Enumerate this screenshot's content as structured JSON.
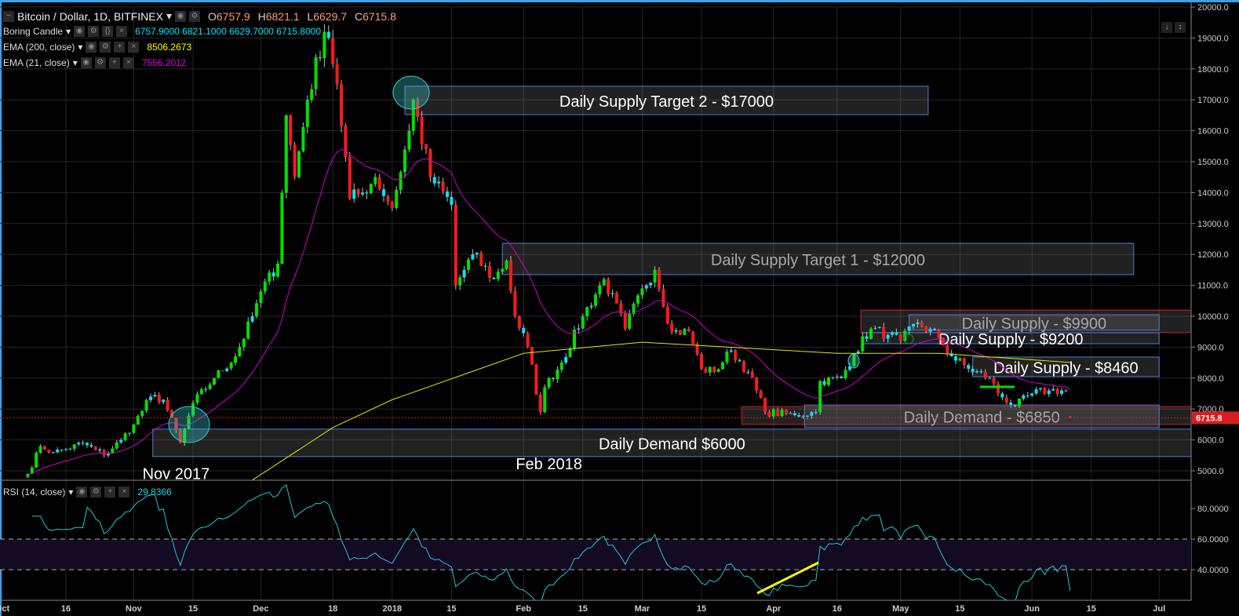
{
  "header": {
    "symbol": "Bitcoin / Dollar, 1D, BITFINEX",
    "open_label": "O",
    "open": "6757.9",
    "high_label": "H",
    "high": "6821.1",
    "low_label": "L",
    "low": "6629.7",
    "close_label": "C",
    "close": "6715.8"
  },
  "indicators": [
    {
      "name": "Boring Candle",
      "values": "6757.9000  6821.1000  6629.7000  6715.8000",
      "color": "#00e5ff"
    },
    {
      "name": "EMA (200, close)",
      "values": "8506.2673",
      "color": "#ffff00"
    },
    {
      "name": "EMA (21, close)",
      "values": "7556.2012",
      "color": "#e000e0"
    }
  ],
  "rsi_legend": {
    "name": "RSI (14, close)",
    "value": "29.8366"
  },
  "colors": {
    "up": "#00e000",
    "down": "#ff1a1a",
    "boring": "#00e5ff",
    "ema200": "#e6e600",
    "ema21": "#d000d0",
    "rsi": "#1fc8d8",
    "zone_blue": "#4a7fd8",
    "zone_red": "#d81e1e",
    "current": "#d81e1e"
  },
  "chart_data": {
    "type": "candlestick",
    "title": "Bitcoin / Dollar, 1D, BITFINEX",
    "start_date": "2017-10-01",
    "x_ticks": [
      {
        "day": 0,
        "label": "Oct"
      },
      {
        "day": 15,
        "label": "16"
      },
      {
        "day": 31,
        "label": "Nov"
      },
      {
        "day": 45,
        "label": "15"
      },
      {
        "day": 61,
        "label": "Dec"
      },
      {
        "day": 78,
        "label": "18"
      },
      {
        "day": 92,
        "label": "2018"
      },
      {
        "day": 106,
        "label": "15"
      },
      {
        "day": 123,
        "label": "Feb"
      },
      {
        "day": 137,
        "label": "15"
      },
      {
        "day": 151,
        "label": "Mar"
      },
      {
        "day": 165,
        "label": "15"
      },
      {
        "day": 182,
        "label": "Apr"
      },
      {
        "day": 197,
        "label": "16"
      },
      {
        "day": 212,
        "label": "May"
      },
      {
        "day": 226,
        "label": "15"
      },
      {
        "day": 243,
        "label": "Jun"
      },
      {
        "day": 257,
        "label": "15"
      },
      {
        "day": 273,
        "label": "Jul"
      }
    ],
    "x_range_days": [
      0,
      280
    ],
    "y_range": [
      4700,
      20150
    ],
    "y_ticks": [
      "20000.0",
      "19000.0",
      "18000.0",
      "17000.0",
      "16000.0",
      "15000.0",
      "14000.0",
      "13000.0",
      "12000.0",
      "11000.0",
      "10000.0",
      "9000.0",
      "8000.0",
      "7000.0",
      "6000.0",
      "5000.0"
    ],
    "current_price": "6715.8",
    "close_anchors": [
      [
        6,
        4900
      ],
      [
        9,
        5800
      ],
      [
        12,
        5600
      ],
      [
        15,
        5700
      ],
      [
        19,
        5900
      ],
      [
        24,
        5500
      ],
      [
        28,
        6000
      ],
      [
        31,
        6500
      ],
      [
        35,
        7400
      ],
      [
        38,
        7300
      ],
      [
        42,
        5900
      ],
      [
        45,
        7200
      ],
      [
        50,
        8000
      ],
      [
        55,
        8700
      ],
      [
        59,
        10000
      ],
      [
        61,
        10800
      ],
      [
        65,
        11700
      ],
      [
        67,
        16500
      ],
      [
        69,
        14500
      ],
      [
        72,
        17000
      ],
      [
        76,
        19200
      ],
      [
        77,
        19000
      ],
      [
        79,
        17500
      ],
      [
        82,
        13800
      ],
      [
        85,
        14000
      ],
      [
        88,
        14500
      ],
      [
        91,
        13700
      ],
      [
        92,
        13500
      ],
      [
        96,
        16000
      ],
      [
        97,
        17000
      ],
      [
        101,
        14500
      ],
      [
        106,
        13600
      ],
      [
        107,
        11000
      ],
      [
        111,
        12000
      ],
      [
        116,
        11200
      ],
      [
        119,
        11800
      ],
      [
        121,
        10000
      ],
      [
        124,
        9000
      ],
      [
        127,
        6900
      ],
      [
        128,
        7700
      ],
      [
        132,
        8500
      ],
      [
        137,
        10000
      ],
      [
        142,
        11200
      ],
      [
        147,
        9600
      ],
      [
        151,
        10900
      ],
      [
        154,
        11500
      ],
      [
        158,
        9500
      ],
      [
        162,
        9500
      ],
      [
        165,
        8300
      ],
      [
        168,
        8200
      ],
      [
        172,
        8900
      ],
      [
        176,
        8200
      ],
      [
        180,
        6900
      ],
      [
        187,
        6800
      ],
      [
        192,
        6900
      ],
      [
        193,
        7900
      ],
      [
        198,
        8000
      ],
      [
        201,
        8800
      ],
      [
        205,
        9600
      ],
      [
        209,
        9400
      ],
      [
        212,
        9200
      ],
      [
        216,
        9800
      ],
      [
        221,
        9300
      ],
      [
        224,
        8700
      ],
      [
        228,
        8300
      ],
      [
        233,
        8000
      ],
      [
        235,
        7500
      ],
      [
        239,
        7100
      ],
      [
        243,
        7500
      ],
      [
        247,
        7600
      ],
      [
        251,
        7600
      ],
      [
        252,
        6716
      ]
    ],
    "ema200_anchors": [
      [
        59,
        4700
      ],
      [
        78,
        6400
      ],
      [
        92,
        7300
      ],
      [
        123,
        8800
      ],
      [
        151,
        9160
      ],
      [
        197,
        8800
      ],
      [
        221,
        8800
      ],
      [
        252,
        8506
      ]
    ],
    "rsi": {
      "period": 14,
      "levels": [
        60,
        40
      ],
      "y_ticks": [
        "80.0000",
        "60.0000",
        "40.0000"
      ],
      "y_range": [
        25,
        95
      ]
    },
    "zones": [
      {
        "label": "Daily Supply Target 2 - $17000",
        "from_day": 95,
        "to_day": 218.5,
        "top": 17440,
        "bottom": 16520,
        "border": "blue",
        "text": "#ffffff"
      },
      {
        "label": "Daily Supply Target 1 - $12000",
        "from_day": 118,
        "to_day": 267,
        "top": 12360,
        "bottom": 11345,
        "border": "blue",
        "text": "#a8a8a8"
      },
      {
        "label": "",
        "from_day": 202.6,
        "to_day": 290,
        "top": 10200,
        "bottom": 9470,
        "border": "red",
        "text": "#a8a8a8"
      },
      {
        "label": "Daily Supply - $9900",
        "from_day": 214,
        "to_day": 273,
        "top": 10050,
        "bottom": 9550,
        "border": "blue",
        "text": "#a8a8a8"
      },
      {
        "label": "Daily Supply - $9200",
        "from_day": 203,
        "to_day": 273,
        "top": 9470,
        "bottom": 9110,
        "border": "blue",
        "text": "#ffffff"
      },
      {
        "label": "Daily Supply - $8460",
        "from_day": 229,
        "to_day": 273,
        "top": 8680,
        "bottom": 8050,
        "border": "blue",
        "text": "#ffffff"
      },
      {
        "label": "",
        "from_day": 174.5,
        "to_day": 290,
        "top": 7080,
        "bottom": 6500,
        "border": "red",
        "text": "#a8a8a8"
      },
      {
        "label": "Daily Demand - $6850",
        "from_day": 189.3,
        "to_day": 273,
        "top": 7130,
        "bottom": 6400,
        "border": "blue",
        "text": "#a8a8a8"
      },
      {
        "label": "Daily Demand $6000",
        "from_day": 35.5,
        "to_day": 290,
        "top": 6350,
        "bottom": 5460,
        "border": "blue",
        "text": "#ffffff"
      }
    ],
    "annotations": [
      {
        "text": "Nov 2017",
        "day": 41,
        "price": 4880
      },
      {
        "text": "Feb 2018",
        "day": 129,
        "price": 5200
      }
    ]
  }
}
